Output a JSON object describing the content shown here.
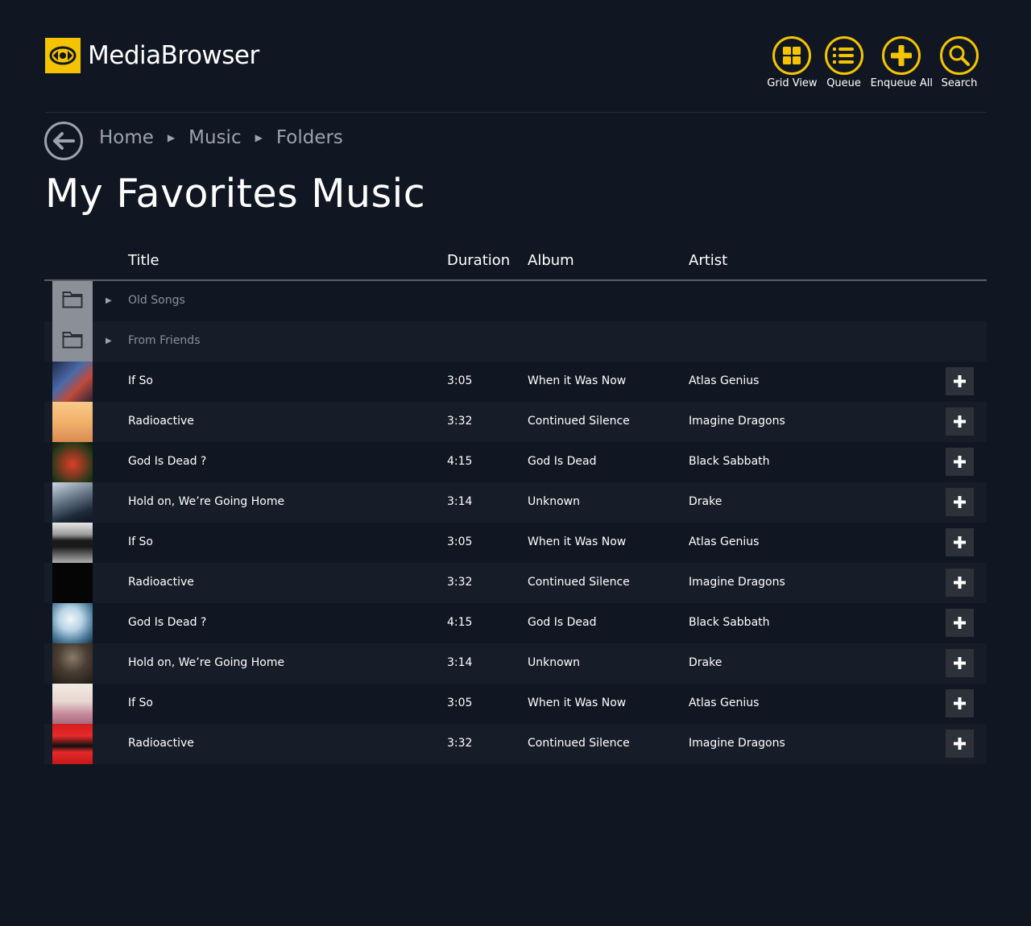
{
  "app": {
    "name_light": "Media",
    "name_bold": "Browser"
  },
  "toolbar": [
    {
      "label": "Grid View",
      "icon": "grid-icon"
    },
    {
      "label": "Queue",
      "icon": "queue-list-icon"
    },
    {
      "label": "Enqueue All",
      "icon": "plus-circle-icon"
    },
    {
      "label": "Search",
      "icon": "search-icon"
    }
  ],
  "breadcrumb": [
    "Home",
    "Music",
    "Folders"
  ],
  "page_title": "My Favorites Music",
  "columns": {
    "title": "Title",
    "duration": "Duration",
    "album": "Album",
    "artist": "Artist"
  },
  "folders": [
    {
      "name": "Old Songs"
    },
    {
      "name": "From Friends"
    }
  ],
  "tracks": [
    {
      "title": "If So",
      "duration": "3:05",
      "album": "When it Was Now",
      "artist": "Atlas Genius"
    },
    {
      "title": "Radioactive",
      "duration": "3:32",
      "album": "Continued Silence",
      "artist": "Imagine Dragons"
    },
    {
      "title": "God Is Dead ?",
      "duration": "4:15",
      "album": "God Is Dead",
      "artist": "Black Sabbath"
    },
    {
      "title": "Hold on, We’re Going Home",
      "duration": "3:14",
      "album": "Unknown",
      "artist": "Drake"
    },
    {
      "title": "If So",
      "duration": "3:05",
      "album": "When it Was Now",
      "artist": "Atlas Genius"
    },
    {
      "title": "Radioactive",
      "duration": "3:32",
      "album": "Continued Silence",
      "artist": "Imagine Dragons"
    },
    {
      "title": "God Is Dead ?",
      "duration": "4:15",
      "album": "God Is Dead",
      "artist": "Black Sabbath"
    },
    {
      "title": "Hold on, We’re Going Home",
      "duration": "3:14",
      "album": "Unknown",
      "artist": "Drake"
    },
    {
      "title": "If So",
      "duration": "3:05",
      "album": "When it Was Now",
      "artist": "Atlas Genius"
    },
    {
      "title": "Radioactive",
      "duration": "3:32",
      "album": "Continued Silence",
      "artist": "Imagine Dragons"
    }
  ],
  "colors": {
    "accent": "#f5c400",
    "background": "#111722",
    "row_alt": "#161d29"
  }
}
